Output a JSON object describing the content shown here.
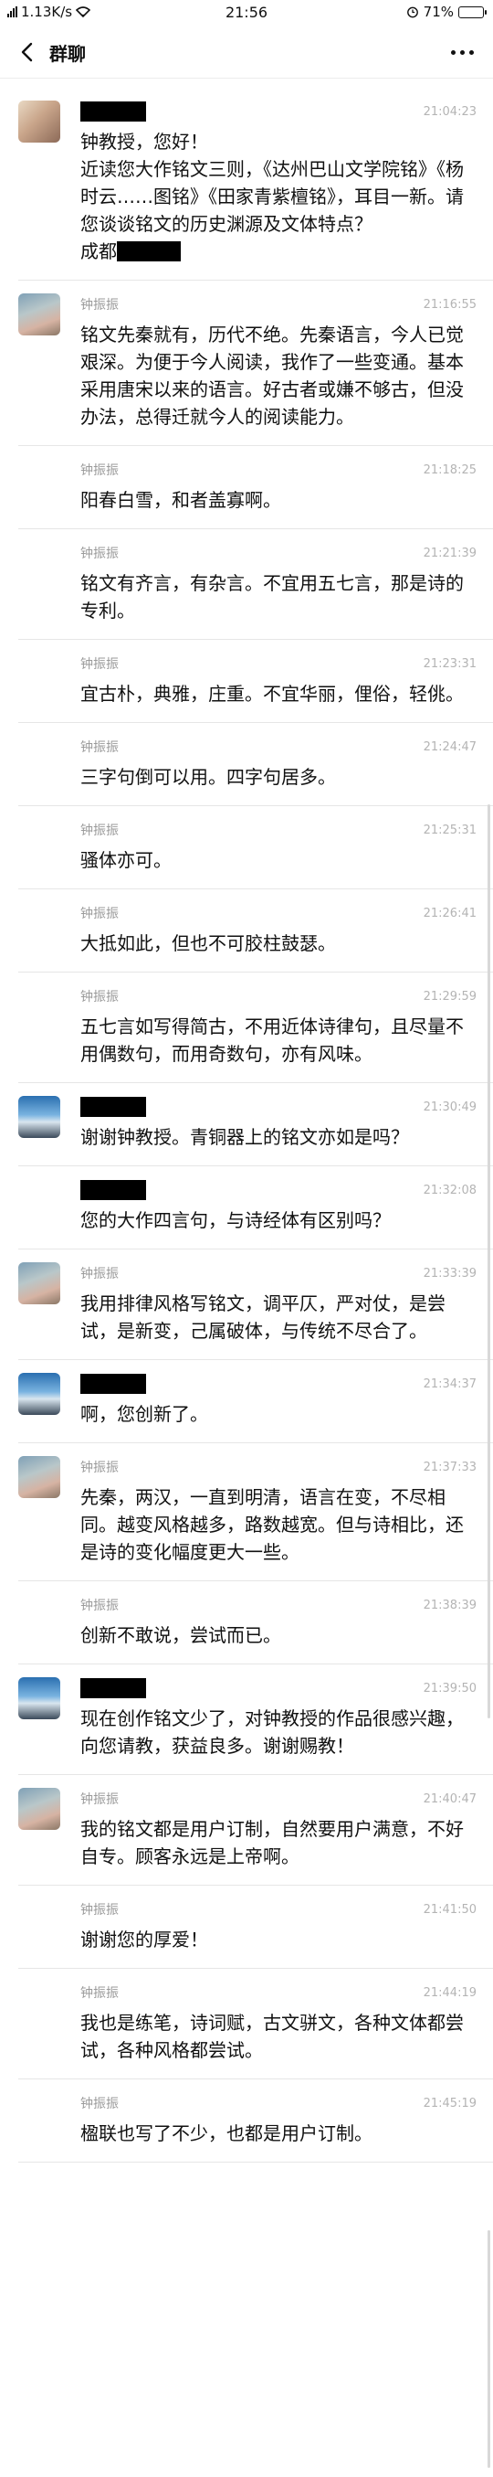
{
  "status_bar": {
    "network_speed": "1.13K/s",
    "time": "21:56",
    "battery": "71%",
    "battery_level": 0.71
  },
  "nav": {
    "title": "群聊"
  },
  "messages": [
    {
      "sender": "",
      "time": "21:04:23",
      "text": "钟教授，您好！\n近读您大作铭文三则，《达州巴山文学院铭》《杨时云……图铭》《田家青紫檀铭》，耳目一新。请您谈谈铭文的历史渊源及文体特点？\n成都",
      "avatar": "portrait"
    },
    {
      "sender": "钟振振",
      "time": "21:16:55",
      "text": "铭文先秦就有，历代不绝。先秦语言，今人已觉艰深。为便于今人阅读，我作了一些变通。基本采用唐宋以来的语言。好古者或嫌不够古，但没办法，总得迁就今人的阅读能力。",
      "avatar": "zhong"
    },
    {
      "sender": "钟振振",
      "time": "21:18:25",
      "text": "阳春白雪，和者盖寡啊。",
      "avatar": ""
    },
    {
      "sender": "钟振振",
      "time": "21:21:39",
      "text": "铭文有齐言，有杂言。不宜用五七言，那是诗的专利。",
      "avatar": ""
    },
    {
      "sender": "钟振振",
      "time": "21:23:31",
      "text": "宜古朴，典雅，庄重。不宜华丽，俚俗，轻佻。",
      "avatar": ""
    },
    {
      "sender": "钟振振",
      "time": "21:24:47",
      "text": "三字句倒可以用。四字句居多。",
      "avatar": ""
    },
    {
      "sender": "钟振振",
      "time": "21:25:31",
      "text": "骚体亦可。",
      "avatar": ""
    },
    {
      "sender": "钟振振",
      "time": "21:26:41",
      "text": "大抵如此，但也不可胶柱鼓瑟。",
      "avatar": ""
    },
    {
      "sender": "钟振振",
      "time": "21:29:59",
      "text": "五七言如写得简古，不用近体诗律句，且尽量不用偶数句，而用奇数句，亦有风味。",
      "avatar": ""
    },
    {
      "sender": "",
      "time": "21:30:49",
      "text": "谢谢钟教授。青铜器上的铭文亦如是吗？",
      "avatar": "sky"
    },
    {
      "sender": "",
      "time": "21:32:08",
      "text": "您的大作四言句，与诗经体有区别吗？",
      "avatar": ""
    },
    {
      "sender": "钟振振",
      "time": "21:33:39",
      "text": "我用排律风格写铭文，调平仄，严对仗，是尝试，是新变，己属破体，与传统不尽合了。",
      "avatar": "zhong"
    },
    {
      "sender": "",
      "time": "21:34:37",
      "text": "啊，您创新了。",
      "avatar": "sky"
    },
    {
      "sender": "钟振振",
      "time": "21:37:33",
      "text": "先秦，两汉，一直到明清，语言在变，不尽相同。越变风格越多，路数越宽。但与诗相比，还是诗的变化幅度更大一些。",
      "avatar": "zhong"
    },
    {
      "sender": "钟振振",
      "time": "21:38:39",
      "text": "创新不敢说，尝试而已。",
      "avatar": ""
    },
    {
      "sender": "",
      "time": "21:39:50",
      "text": "现在创作铭文少了，对钟教授的作品很感兴趣，向您请教，获益良多。谢谢赐教！",
      "avatar": "sky"
    },
    {
      "sender": "钟振振",
      "time": "21:40:47",
      "text": "我的铭文都是用户订制，自然要用户满意，不好自专。顾客永远是上帝啊。",
      "avatar": "zhong"
    },
    {
      "sender": "钟振振",
      "time": "21:41:50",
      "text": "谢谢您的厚爱！",
      "avatar": ""
    },
    {
      "sender": "钟振振",
      "time": "21:44:19",
      "text": "我也是练笔，诗词赋，古文骈文，各种文体都尝试，各种风格都尝试。",
      "avatar": ""
    },
    {
      "sender": "钟振振",
      "time": "21:45:19",
      "text": "楹联也写了不少，也都是用户订制。",
      "avatar": ""
    }
  ]
}
